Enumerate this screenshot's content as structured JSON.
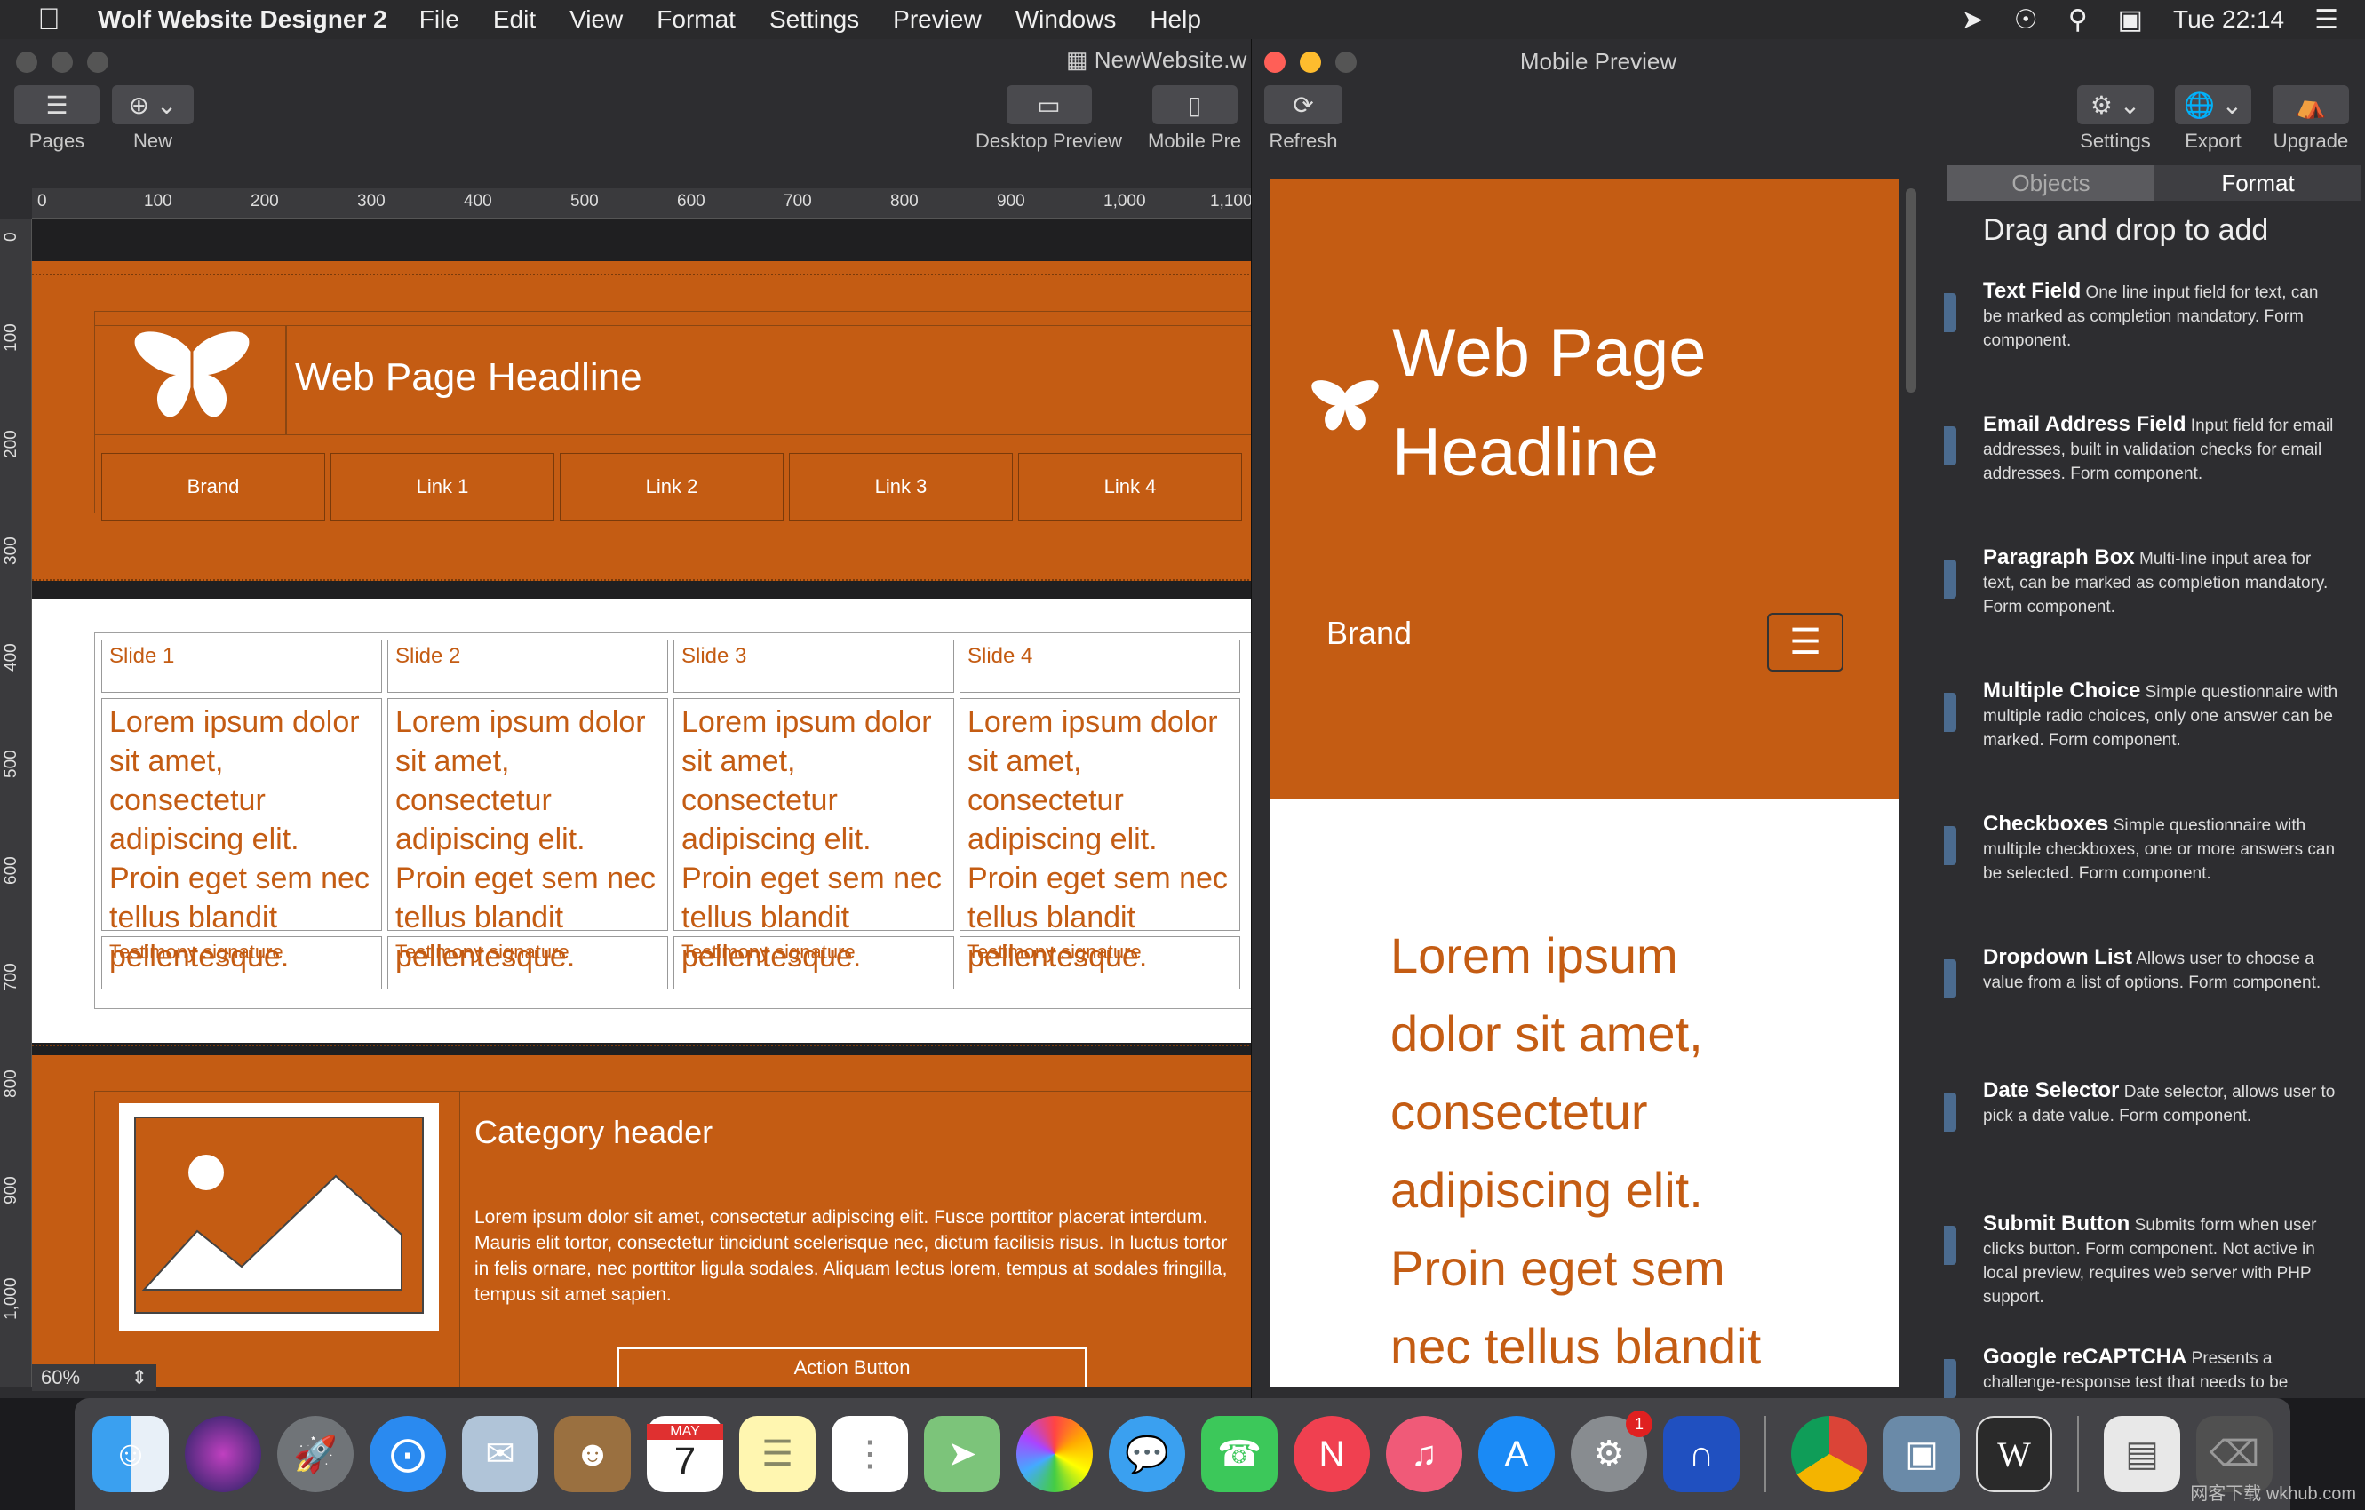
{
  "menubar": {
    "app_name": "Wolf Website Designer 2",
    "items": [
      "File",
      "Edit",
      "View",
      "Format",
      "Settings",
      "Preview",
      "Windows",
      "Help"
    ],
    "clock": "Tue 22:14"
  },
  "main_window": {
    "doc_title": "NewWebsite.w",
    "toolbar": {
      "pages": "Pages",
      "new": "New",
      "desktop_preview": "Desktop Preview",
      "mobile_preview": "Mobile Pre"
    },
    "ruler_top": [
      "0",
      "100",
      "200",
      "300",
      "400",
      "500",
      "600",
      "700",
      "800",
      "900",
      "1,000",
      "1,100"
    ],
    "ruler_left": [
      "0",
      "100",
      "200",
      "300",
      "400",
      "500",
      "600",
      "700",
      "800",
      "900",
      "1,000"
    ],
    "zoom": "60%",
    "page": {
      "headline": "Web Page Headline",
      "nav": [
        "Brand",
        "Link 1",
        "Link 2",
        "Link 3",
        "Link 4"
      ],
      "slides": [
        {
          "title": "Slide 1",
          "body": "Lorem ipsum dolor sit amet, consectetur adipiscing elit. Proin eget sem nec tellus blandit pellentesque.",
          "signature": "Testimony signature"
        },
        {
          "title": "Slide 2",
          "body": "Lorem ipsum dolor sit amet, consectetur adipiscing elit. Proin eget sem nec tellus blandit pellentesque.",
          "signature": "Testimony signature"
        },
        {
          "title": "Slide 3",
          "body": "Lorem ipsum dolor sit amet, consectetur adipiscing elit. Proin eget sem nec tellus blandit pellentesque.",
          "signature": "Testimony signature"
        },
        {
          "title": "Slide 4",
          "body": "Lorem ipsum dolor sit amet, consectetur adipiscing elit. Proin eget sem nec tellus blandit pellentesque.",
          "signature": "Testimony signature"
        }
      ],
      "category_header": "Category header",
      "category_text": "Lorem ipsum dolor sit amet, consectetur adipiscing elit. Fusce porttitor placerat interdum. Mauris elit tortor, consectetur tincidunt scelerisque nec, dictum facilisis risus. In luctus tortor in felis ornare, nec porttitor ligula sodales. Aliquam lectus lorem, tempus at sodales fringilla, tempus sit amet sapien.",
      "action_button": "Action Button"
    }
  },
  "mobile_window": {
    "title": "Mobile Preview",
    "refresh": "Refresh",
    "headline_line1": "Web Page",
    "headline_line2": "Headline",
    "brand": "Brand",
    "body_lines": [
      "Lorem ipsum",
      "dolor sit amet,",
      "consectetur",
      "adipiscing elit.",
      "Proin eget sem",
      "nec tellus blandit"
    ]
  },
  "right_panel": {
    "toolbar": {
      "settings": "Settings",
      "export": "Export",
      "upgrade": "Upgrade"
    },
    "tabs": {
      "objects": "Objects",
      "format": "Format"
    },
    "drag_title": "Drag and drop to add",
    "objects": [
      {
        "name": "Text Field",
        "desc": "One line input field for text, can be marked as completion mandatory. Form component."
      },
      {
        "name": "Email Address Field",
        "desc": "Input field for email addresses, built in validation checks for email addresses.  Form component."
      },
      {
        "name": "Paragraph Box",
        "desc": "Multi-line input area for text, can be marked as completion mandatory.  Form component."
      },
      {
        "name": "Multiple Choice",
        "desc": "Simple questionnaire with multiple radio choices, only one answer can be marked.  Form component."
      },
      {
        "name": "Checkboxes",
        "desc": "Simple questionnaire with multiple checkboxes, one or more answers can be selected.  Form component."
      },
      {
        "name": "Dropdown List",
        "desc": "Allows user to choose a value from a list of options.  Form component."
      },
      {
        "name": "Date Selector",
        "desc": "Date selector, allows user to pick a date value.  Form component."
      },
      {
        "name": "Submit Button",
        "desc": "Submits form when user clicks button.  Form component.  Not active in local preview, requires web server with PHP support."
      },
      {
        "name": "Google reCAPTCHA",
        "desc": "Presents a challenge-response test that needs to be"
      }
    ]
  },
  "dock": {
    "calendar_month": "MAY",
    "calendar_day": "7",
    "settings_badge": "1",
    "watermark": "网客下载 wkhub.com"
  },
  "colors": {
    "accent_orange": "#c45c13",
    "panel_dark": "#2d2d30"
  }
}
